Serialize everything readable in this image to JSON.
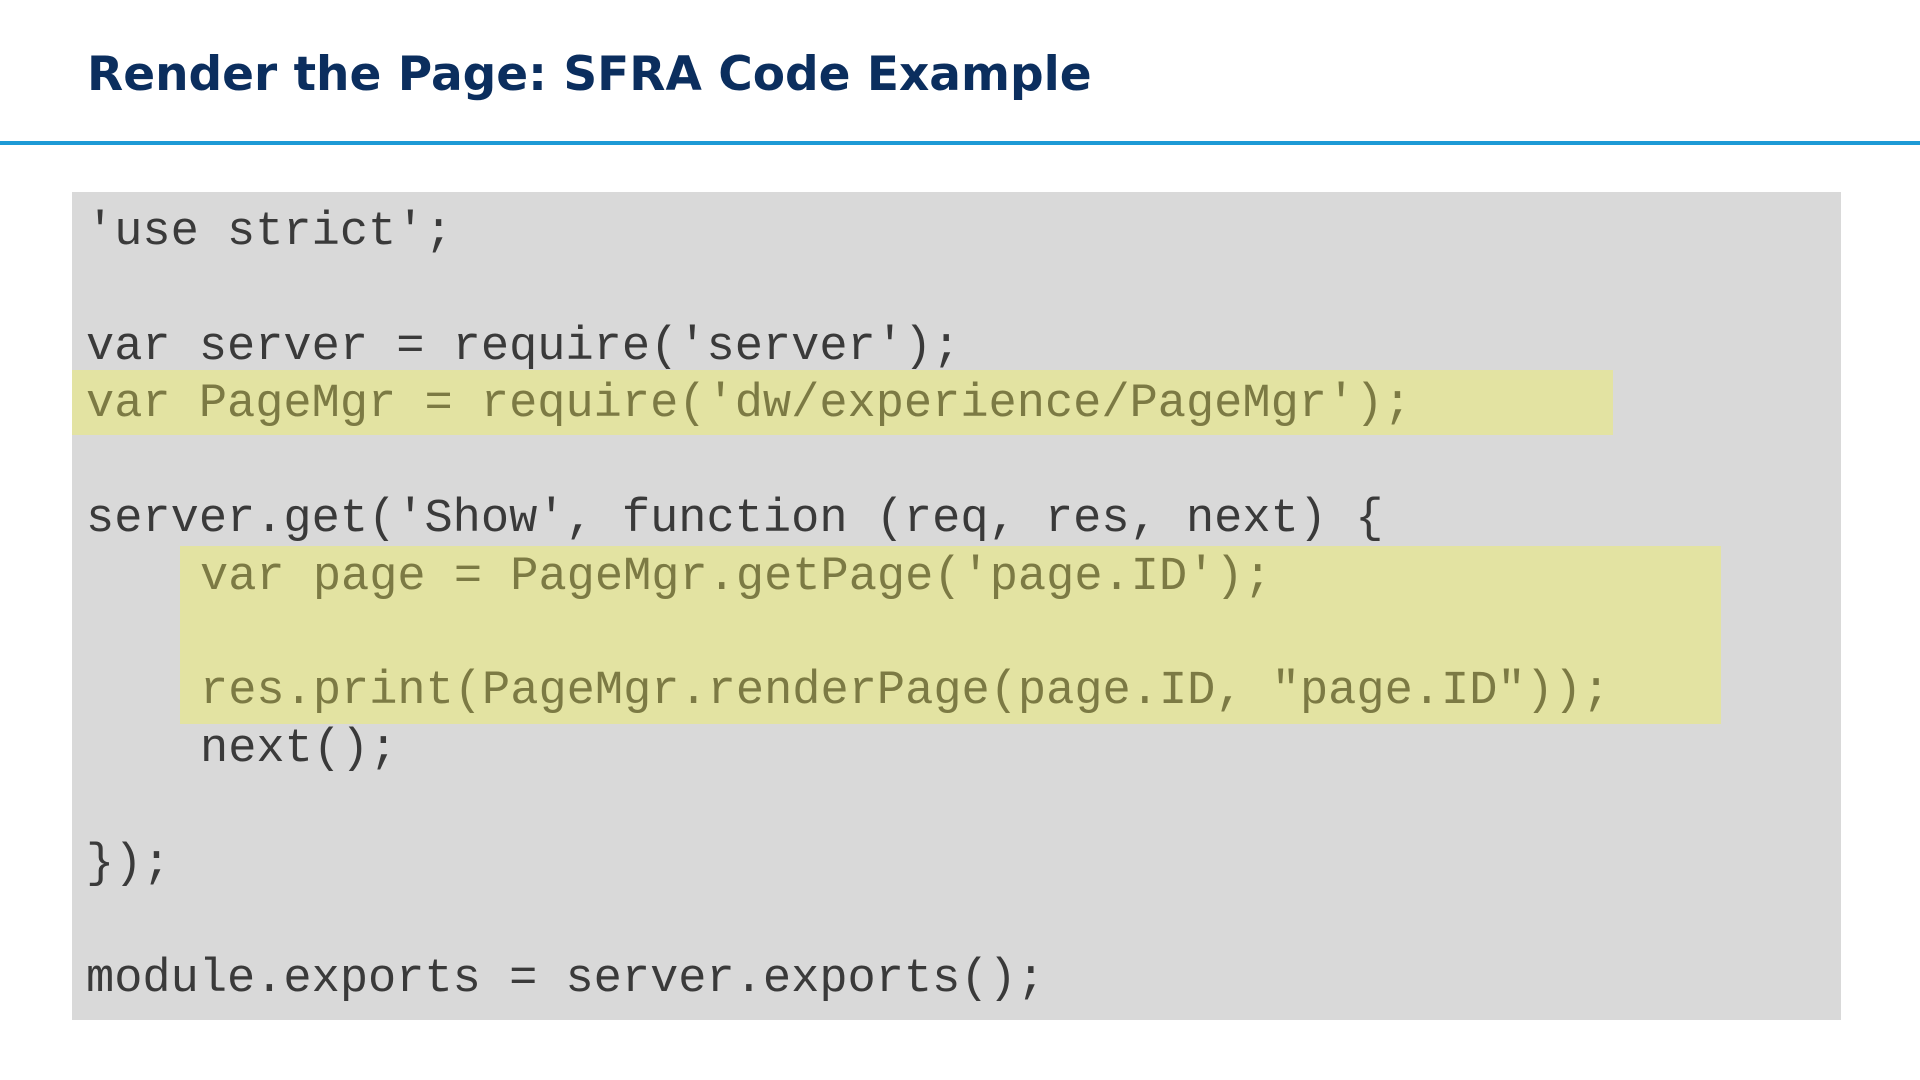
{
  "slide": {
    "title": "Render the Page: SFRA Code Example"
  },
  "colors": {
    "title": "#0b2e5e",
    "rule": "#1d9ad6",
    "code_background": "#d9d9d9",
    "code_text": "#3a3a3a",
    "highlight": "#e3e3a2",
    "highlight_text": "#7c7a44"
  },
  "code": {
    "lines": [
      {
        "text": "'use strict';",
        "highlighted": false,
        "indent": 0
      },
      {
        "text": "var server = require('server');",
        "highlighted": false,
        "indent": 0
      },
      {
        "text": "var PageMgr = require('dw/experience/PageMgr');",
        "highlighted": true,
        "indent": 0
      },
      {
        "text": "server.get('Show', function (req, res, next) {",
        "highlighted": false,
        "indent": 0
      },
      {
        "text": "var page = PageMgr.getPage('page.ID');",
        "highlighted": true,
        "indent": 1
      },
      {
        "text": "res.print(PageMgr.renderPage(page.ID, \"page.ID\"));",
        "highlighted": true,
        "indent": 1
      },
      {
        "text": "next();",
        "highlighted": false,
        "indent": 1
      },
      {
        "text": "});",
        "highlighted": false,
        "indent": 0
      },
      {
        "text": "module.exports = server.exports();",
        "highlighted": false,
        "indent": 0
      }
    ]
  }
}
